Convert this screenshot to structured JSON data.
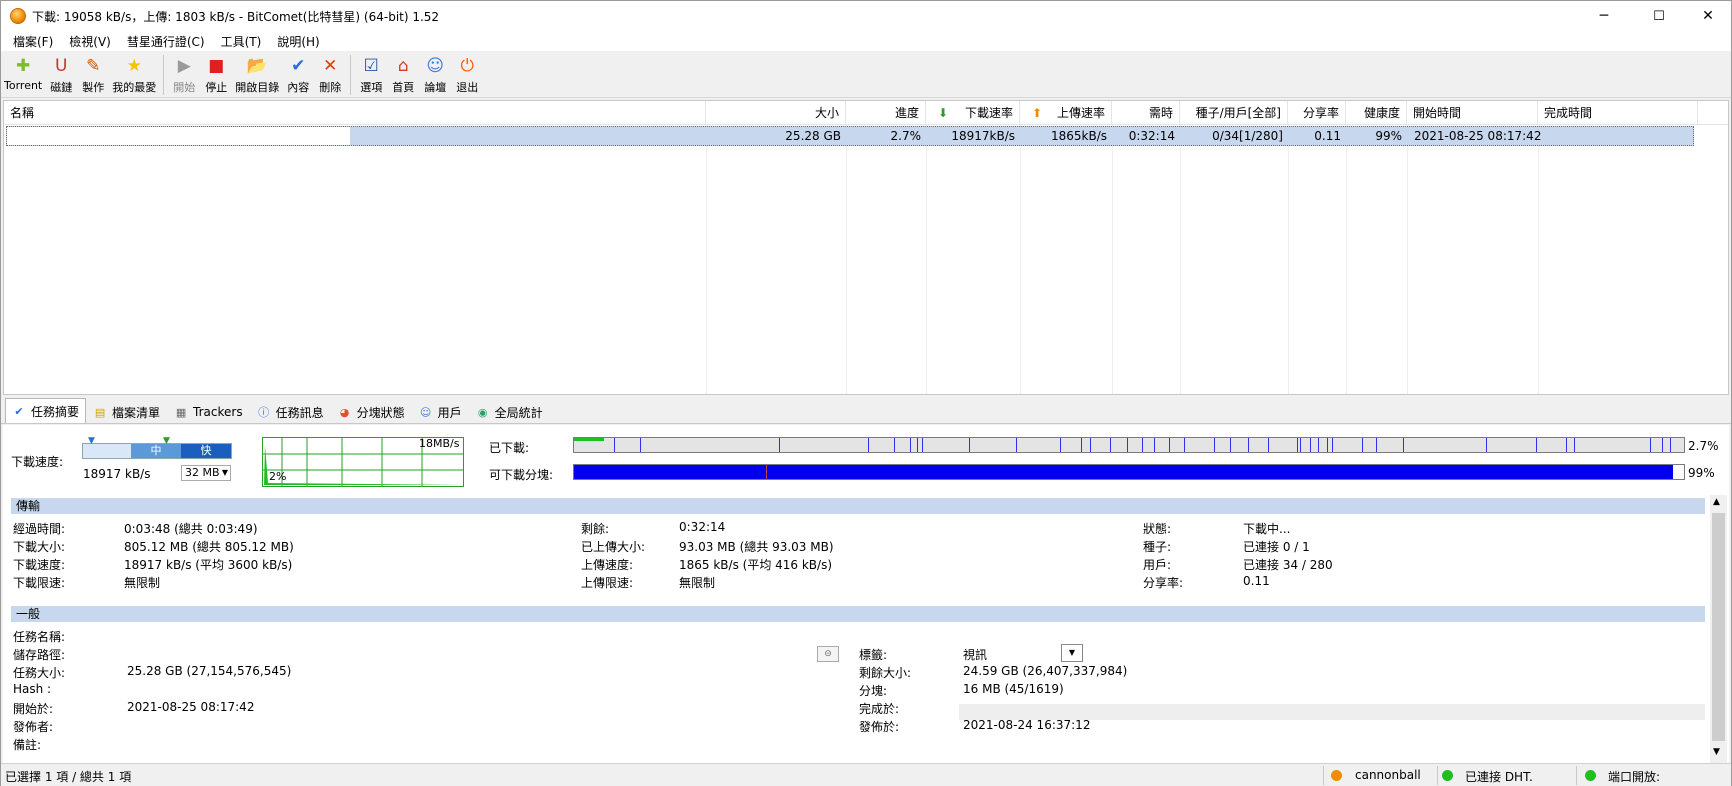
{
  "window": {
    "title": "下載: 19058 kB/s，上傳: 1803 kB/s - BitComet(比特彗星) (64-bit) 1.52",
    "minimize": "─",
    "maximize": "☐",
    "close": "✕"
  },
  "menu": [
    "檔案(F)",
    "檢視(V)",
    "彗星通行證(C)",
    "工具(T)",
    "說明(H)"
  ],
  "toolbar": [
    {
      "label": "Torrent",
      "icon": "torrent-icon",
      "glyph": "✚",
      "color": "#7cbd2a"
    },
    {
      "label": "磁鏈",
      "icon": "magnet-icon",
      "glyph": "U",
      "color": "#c0392b"
    },
    {
      "label": "製作",
      "icon": "make-torrent-icon",
      "glyph": "✎",
      "color": "#d35400"
    },
    {
      "label": "我的最愛",
      "icon": "favorites-star-icon",
      "glyph": "★",
      "color": "#f5c400"
    },
    {
      "label": "開始",
      "icon": "start-icon",
      "glyph": "▶",
      "color": "#9a9a9a"
    },
    {
      "label": "停止",
      "icon": "stop-icon",
      "glyph": "■",
      "color": "#e02020"
    },
    {
      "label": "開啟目錄",
      "icon": "open-folder-icon",
      "glyph": "📂",
      "color": "#e8b800"
    },
    {
      "label": "內容",
      "icon": "properties-icon",
      "glyph": "✔",
      "color": "#2a6fd6"
    },
    {
      "label": "刪除",
      "icon": "delete-icon",
      "glyph": "✕",
      "color": "#e04000"
    },
    {
      "label": "選項",
      "icon": "options-icon",
      "glyph": "☑",
      "color": "#2255aa"
    },
    {
      "label": "首頁",
      "icon": "home-icon",
      "glyph": "⌂",
      "color": "#d04020"
    },
    {
      "label": "論壇",
      "icon": "forum-icon",
      "glyph": "☺",
      "color": "#3a7bd5"
    },
    {
      "label": "退出",
      "icon": "exit-power-icon",
      "glyph": "⏻",
      "color": "#ff5500"
    }
  ],
  "list": {
    "columns": [
      "名稱",
      "大小",
      "進度",
      "下載速率",
      "上傳速率",
      "需時",
      "種子/用戶[全部]",
      "分享率",
      "健康度",
      "開始時間",
      "完成時間"
    ],
    "rows": [
      {
        "name": "",
        "size": "25.28 GB",
        "progress": "2.7%",
        "down": "18917kB/s",
        "up": "1865kB/s",
        "eta": "0:32:14",
        "peers": "0/34[1/280]",
        "ratio": "0.11",
        "health": "99%",
        "start": "2021-08-25 08:17:42",
        "done": ""
      }
    ]
  },
  "tabs": [
    "任務摘要",
    "檔案清單",
    "Trackers",
    "任務訊息",
    "分塊狀態",
    "用戶",
    "全局統計"
  ],
  "summary": {
    "speed_label": "下載速度:",
    "slider_mid": "中",
    "slider_fast": "快",
    "current_speed": "18917 kB/s",
    "cache": "32 MB",
    "graph_max": "18MB/s",
    "graph_pct": "2%",
    "downloaded_label": "已下載:",
    "downloaded_pct": "2.7%",
    "available_label": "可下載分塊:",
    "available_pct": "99%",
    "progress_fraction": 0.027,
    "available_fraction": 0.99
  },
  "transfer": {
    "title": "傳輸",
    "left": [
      [
        "經過時間:",
        "0:03:48 (總共 0:03:49)"
      ],
      [
        "下載大小:",
        "805.12 MB (總共 805.12 MB)"
      ],
      [
        "下載速度:",
        "18917 kB/s (平均 3600 kB/s)"
      ],
      [
        "下載限速:",
        "無限制"
      ]
    ],
    "mid": [
      [
        "剩餘:",
        "0:32:14"
      ],
      [
        "已上傳大小:",
        "93.03 MB (總共 93.03 MB)"
      ],
      [
        "上傳速度:",
        "1865 kB/s (平均 416 kB/s)"
      ],
      [
        "上傳限速:",
        "無限制"
      ]
    ],
    "right": [
      [
        "狀態:",
        "下載中..."
      ],
      [
        "種子:",
        "已連接 0 / 1"
      ],
      [
        "用戶:",
        "已連接 34 / 280"
      ],
      [
        "分享率:",
        "0.11"
      ]
    ]
  },
  "general": {
    "title": "一般",
    "left": [
      [
        "任務名稱:",
        ""
      ],
      [
        "儲存路徑:",
        ""
      ],
      [
        "任務大小:",
        "25.28 GB (27,154,576,545)"
      ],
      [
        "Hash :",
        ""
      ],
      [
        "開始於:",
        "2021-08-25 08:17:42"
      ],
      [
        "發佈者:",
        ""
      ],
      [
        "備註:",
        ""
      ]
    ],
    "right": [
      [
        "標籤:",
        "視訊"
      ],
      [
        "剩餘大小:",
        "24.59 GB (26,407,337,984)"
      ],
      [
        "分塊:",
        "16 MB (45/1619)"
      ],
      [
        "完成於:",
        ""
      ],
      [
        "發佈於:",
        "2021-08-24 16:37:12"
      ]
    ]
  },
  "status": {
    "selection": "已選擇 1 項 / 總共 1 項",
    "user": "cannonball",
    "dht": "已連接 DHT.",
    "port": "端口開放:"
  },
  "colors": {
    "selection": "#c7d7ee",
    "blue_bar": "#0000ee",
    "green": "#1fbf1f",
    "orange": "#f08c00"
  }
}
